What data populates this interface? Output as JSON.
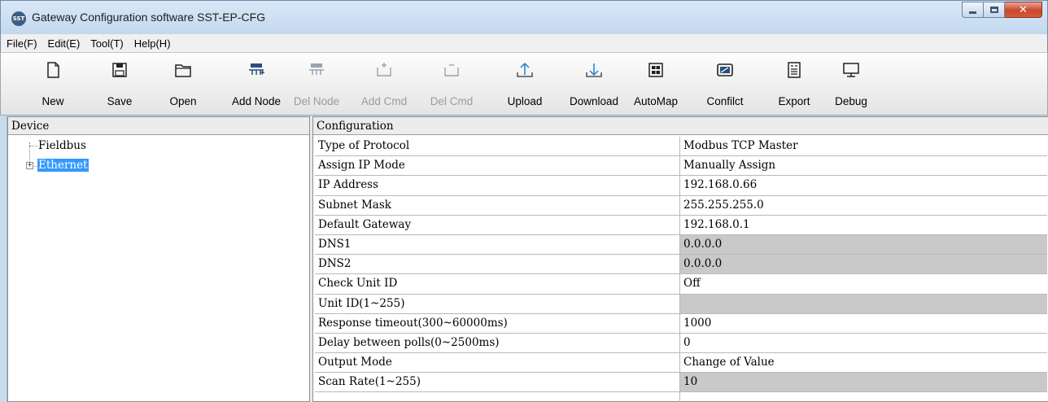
{
  "window": {
    "title": "Gateway Configuration software SST-EP-CFG",
    "icon_text": "SST"
  },
  "menu": [
    "File(F)",
    "Edit(E)",
    "Tool(T)",
    "Help(H)"
  ],
  "toolbar": [
    {
      "label": "New",
      "icon": "new-file-icon",
      "enabled": true
    },
    {
      "label": "Save",
      "icon": "save-icon",
      "enabled": true
    },
    {
      "label": "Open",
      "icon": "open-folder-icon",
      "enabled": true
    },
    {
      "label": "Add Node",
      "icon": "add-node-icon",
      "enabled": true
    },
    {
      "label": "Del Node",
      "icon": "del-node-icon",
      "enabled": false
    },
    {
      "label": "Add Cmd",
      "icon": "add-cmd-icon",
      "enabled": false
    },
    {
      "label": "Del Cmd",
      "icon": "del-cmd-icon",
      "enabled": false
    },
    {
      "label": "Upload",
      "icon": "upload-icon",
      "enabled": true
    },
    {
      "label": "Download",
      "icon": "download-icon",
      "enabled": true
    },
    {
      "label": "AutoMap",
      "icon": "automap-icon",
      "enabled": true
    },
    {
      "label": "Confilct",
      "icon": "conflict-icon",
      "enabled": true
    },
    {
      "label": "Export",
      "icon": "export-icon",
      "enabled": true
    },
    {
      "label": "Debug",
      "icon": "debug-monitor-icon",
      "enabled": true
    }
  ],
  "device_panel": {
    "header": "Device",
    "tree": [
      {
        "label": "Fieldbus",
        "expandable": false,
        "selected": false
      },
      {
        "label": "Ethernet",
        "expandable": true,
        "selected": true
      }
    ]
  },
  "config_panel": {
    "header": "Configuration",
    "rows": [
      {
        "name": "Type of Protocol",
        "value": "Modbus TCP Master",
        "readonly": false
      },
      {
        "name": "Assign IP Mode",
        "value": "Manually Assign",
        "readonly": false
      },
      {
        "name": "IP Address",
        "value": "192.168.0.66",
        "readonly": false
      },
      {
        "name": "Subnet Mask",
        "value": "255.255.255.0",
        "readonly": false
      },
      {
        "name": "Default Gateway",
        "value": "192.168.0.1",
        "readonly": false
      },
      {
        "name": "DNS1",
        "value": "0.0.0.0",
        "readonly": true
      },
      {
        "name": "DNS2",
        "value": "0.0.0.0",
        "readonly": true
      },
      {
        "name": "Check Unit ID",
        "value": "Off",
        "readonly": false
      },
      {
        "name": "Unit ID(1~255)",
        "value": "",
        "readonly": true
      },
      {
        "name": "Response timeout(300~60000ms)",
        "value": "1000",
        "readonly": false
      },
      {
        "name": "Delay between polls(0~2500ms)",
        "value": "0",
        "readonly": false
      },
      {
        "name": "Output Mode",
        "value": "Change of Value",
        "readonly": false
      },
      {
        "name": "Scan Rate(1~255)",
        "value": "10",
        "readonly": true
      },
      {
        "name": "",
        "value": "",
        "readonly": false
      }
    ]
  },
  "colors": {
    "selection": "#3399ff",
    "readonly_cell": "#c9c9c9",
    "titlebar": "#c3d8ee"
  }
}
